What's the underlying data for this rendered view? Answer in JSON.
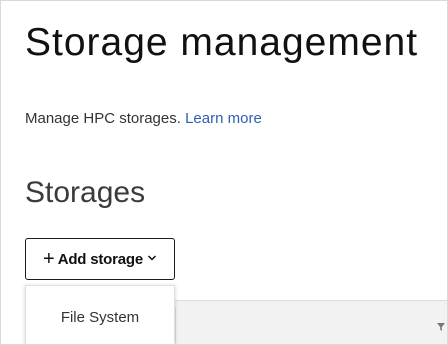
{
  "header": {
    "title": "Storage management",
    "description": "Manage HPC storages.",
    "learn_more": "Learn more"
  },
  "storages": {
    "section_title": "Storages",
    "add_button": {
      "label": "Add storage",
      "plus_icon": "plus-icon",
      "chevron_icon": "chevron-down-icon"
    },
    "dropdown": {
      "items": [
        "File System"
      ]
    },
    "table": {
      "filter_icon": "filter-icon"
    }
  }
}
